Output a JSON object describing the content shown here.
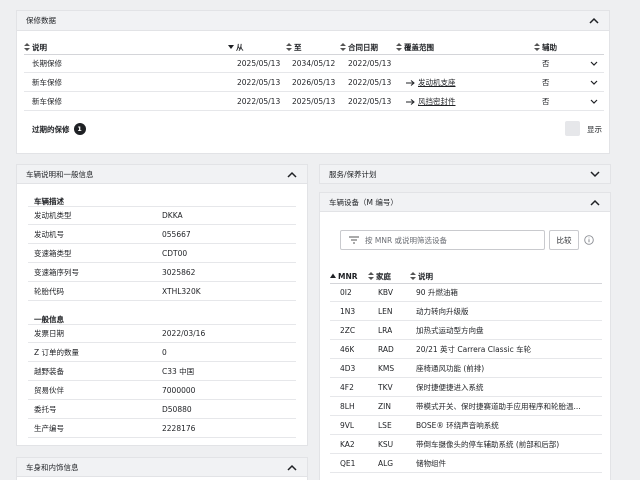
{
  "warranty": {
    "title": "保修数据",
    "columns": [
      "说明",
      "从",
      "至",
      "合同日期",
      "覆盖范围",
      "辅助"
    ],
    "rows": [
      {
        "desc": "长期保修",
        "from": "2025/05/13",
        "to": "2034/05/12",
        "contract": "2022/05/13",
        "coverage": "",
        "aux": "否"
      },
      {
        "desc": "新车保修",
        "from": "2022/05/13",
        "to": "2026/05/13",
        "contract": "2022/05/13",
        "coverage": "发动机支座",
        "aux": "否"
      },
      {
        "desc": "新车保修",
        "from": "2022/05/13",
        "to": "2025/05/13",
        "contract": "2022/05/13",
        "coverage": "风挡密封件",
        "aux": "否"
      }
    ],
    "expired_label": "过期的保修",
    "expired_count": "1",
    "show_label": "显示"
  },
  "vehicle_info": {
    "title": "车辆说明和一般信息",
    "desc_heading": "车辆描述",
    "desc_items": [
      {
        "label": "发动机类型",
        "value": "DKKA"
      },
      {
        "label": "发动机号",
        "value": "055667"
      },
      {
        "label": "变速箱类型",
        "value": "CDT00"
      },
      {
        "label": "变速箱序列号",
        "value": "3025862"
      },
      {
        "label": "轮胎代码",
        "value": "XTHL320K"
      }
    ],
    "general_heading": "一般信息",
    "general_items": [
      {
        "label": "发票日期",
        "value": "2022/03/16"
      },
      {
        "label": "Z 订单的数量",
        "value": "0"
      },
      {
        "label": "越野装备",
        "value": "C33 中国"
      },
      {
        "label": "贸易伙伴",
        "value": "7000000"
      },
      {
        "label": "委托号",
        "value": "D50880"
      },
      {
        "label": "生产编号",
        "value": "2228176"
      }
    ]
  },
  "body_interior": {
    "title": "车身和内饰信息"
  },
  "service": {
    "title": "服务/保养计划"
  },
  "equipment": {
    "title": "车辆设备（M 编号）",
    "search_placeholder": "按 MNR 或说明筛选设备",
    "compare_label": "比较",
    "columns": [
      "MNR",
      "家庭",
      "说明"
    ],
    "rows": [
      {
        "mnr": "0I2",
        "family": "KBV",
        "desc": "90 升燃油箱"
      },
      {
        "mnr": "1N3",
        "family": "LEN",
        "desc": "动力转向升级版"
      },
      {
        "mnr": "2ZC",
        "family": "LRA",
        "desc": "加热式运动型方向盘"
      },
      {
        "mnr": "46K",
        "family": "RAD",
        "desc": "20/21 英寸 Carrera Classic 车轮"
      },
      {
        "mnr": "4D3",
        "family": "KMS",
        "desc": "座椅通风功能 (前排)"
      },
      {
        "mnr": "4F2",
        "family": "TKV",
        "desc": "保时捷便捷进入系统"
      },
      {
        "mnr": "8LH",
        "family": "ZIN",
        "desc": "带模式开关、保时捷赛道助手应用程序和轮胎温..."
      },
      {
        "mnr": "9VL",
        "family": "LSE",
        "desc": "BOSE® 环绕声音响系统"
      },
      {
        "mnr": "KA2",
        "family": "KSU",
        "desc": "带倒车摄像头的停车辅助系统 (前部和后部)"
      },
      {
        "mnr": "QE1",
        "family": "ALG",
        "desc": "储物组件"
      }
    ]
  }
}
